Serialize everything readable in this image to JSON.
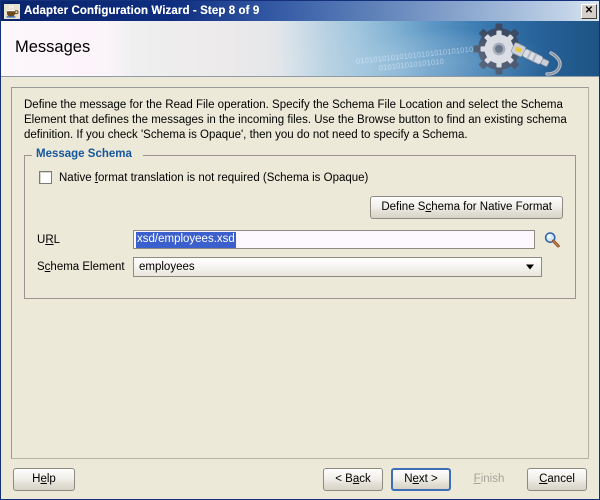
{
  "window": {
    "title": "Adapter Configuration Wizard - Step 8 of 9",
    "app_icon": "coffee-cup-icon",
    "close_label": "✕"
  },
  "banner": {
    "heading": "Messages",
    "binary_line1": "0101010101010101010101010101",
    "binary_line2": "010101010101010",
    "graphic": "gear-wrench-icon"
  },
  "main": {
    "description": "Define the message for the Read File operation.  Specify the Schema File Location and select the Schema Element that defines the messages in the incoming files. Use the Browse button to find an existing schema definition. If you check 'Schema is Opaque', then you do not need to specify a Schema."
  },
  "message_schema": {
    "legend": "Message Schema",
    "opaque_checkbox": {
      "label_before": "Native ",
      "mnemonic": "f",
      "label_after": "ormat translation is not required (Schema is Opaque)",
      "checked": false
    },
    "define_button": {
      "label_before": "Define S",
      "mnemonic": "c",
      "label_after": "hema for Native Format"
    },
    "url": {
      "label_before": "U",
      "mnemonic": "R",
      "label_after": "L",
      "value": "xsd/employees.xsd",
      "selected": true,
      "browse_icon": "magnifier-icon"
    },
    "schema_element": {
      "label_before": "S",
      "mnemonic": "c",
      "label_after": "hema Element",
      "value": "employees",
      "options": [
        "employees"
      ]
    }
  },
  "footer": {
    "help": {
      "before": "H",
      "mnemonic": "e",
      "after": "lp"
    },
    "back": {
      "before": "< B",
      "mnemonic": "a",
      "after": "ck"
    },
    "next": {
      "before": "N",
      "mnemonic": "e",
      "after": "xt >",
      "focused": true
    },
    "finish": {
      "before": "",
      "mnemonic": "F",
      "after": "inish",
      "disabled": true
    },
    "cancel": {
      "before": "",
      "mnemonic": "C",
      "after": "ancel"
    }
  },
  "colors": {
    "titlebar_start": "#0a246a",
    "legend_blue": "#16569e",
    "selection_blue": "#3c5fce",
    "face": "#ece9d8",
    "focus_border": "#3c6fb5"
  }
}
